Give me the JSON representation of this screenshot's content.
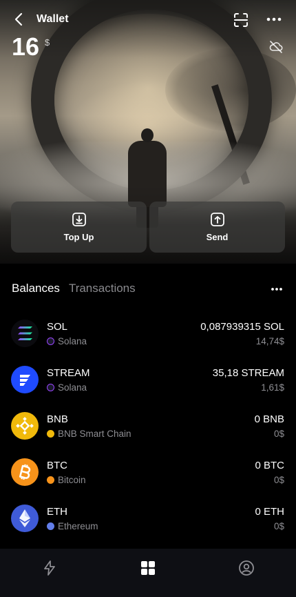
{
  "header": {
    "title": "Wallet",
    "balance_amount": "16",
    "balance_currency": "$",
    "icons": [
      "back-icon",
      "scan-icon",
      "more-icon",
      "cloud-off-icon"
    ]
  },
  "actions": {
    "top_up_label": "Top Up",
    "send_label": "Send"
  },
  "tabs": {
    "balances": "Balances",
    "transactions": "Transactions",
    "active": "Balances"
  },
  "assets": [
    {
      "symbol": "SOL",
      "chain": "Solana",
      "amount": "0,087939315 SOL",
      "fiat": "14,74$",
      "logo_color": "#0b0b0f",
      "chain_color": "#9945ff"
    },
    {
      "symbol": "STREAM",
      "chain": "Solana",
      "amount": "35,18 STREAM",
      "fiat": "1,61$",
      "logo_color": "#1f4bff",
      "chain_color": "#9945ff"
    },
    {
      "symbol": "BNB",
      "chain": "BNB Smart Chain",
      "amount": "0 BNB",
      "fiat": "0$",
      "logo_color": "#f0b90b",
      "chain_color": "#f0b90b"
    },
    {
      "symbol": "BTC",
      "chain": "Bitcoin",
      "amount": "0 BTC",
      "fiat": "0$",
      "logo_color": "#f7931a",
      "chain_color": "#f7931a"
    },
    {
      "symbol": "ETH",
      "chain": "Ethereum",
      "amount": "0 ETH",
      "fiat": "0$",
      "logo_color": "#3f5bd8",
      "chain_color": "#627eea"
    }
  ],
  "bottom_nav": {
    "items": [
      "lightning-icon",
      "grid-icon",
      "profile-icon"
    ],
    "active": "grid-icon"
  },
  "colors": {
    "background": "#000000",
    "secondary_text": "#8e8e93",
    "nav_background": "#0e0f14"
  }
}
